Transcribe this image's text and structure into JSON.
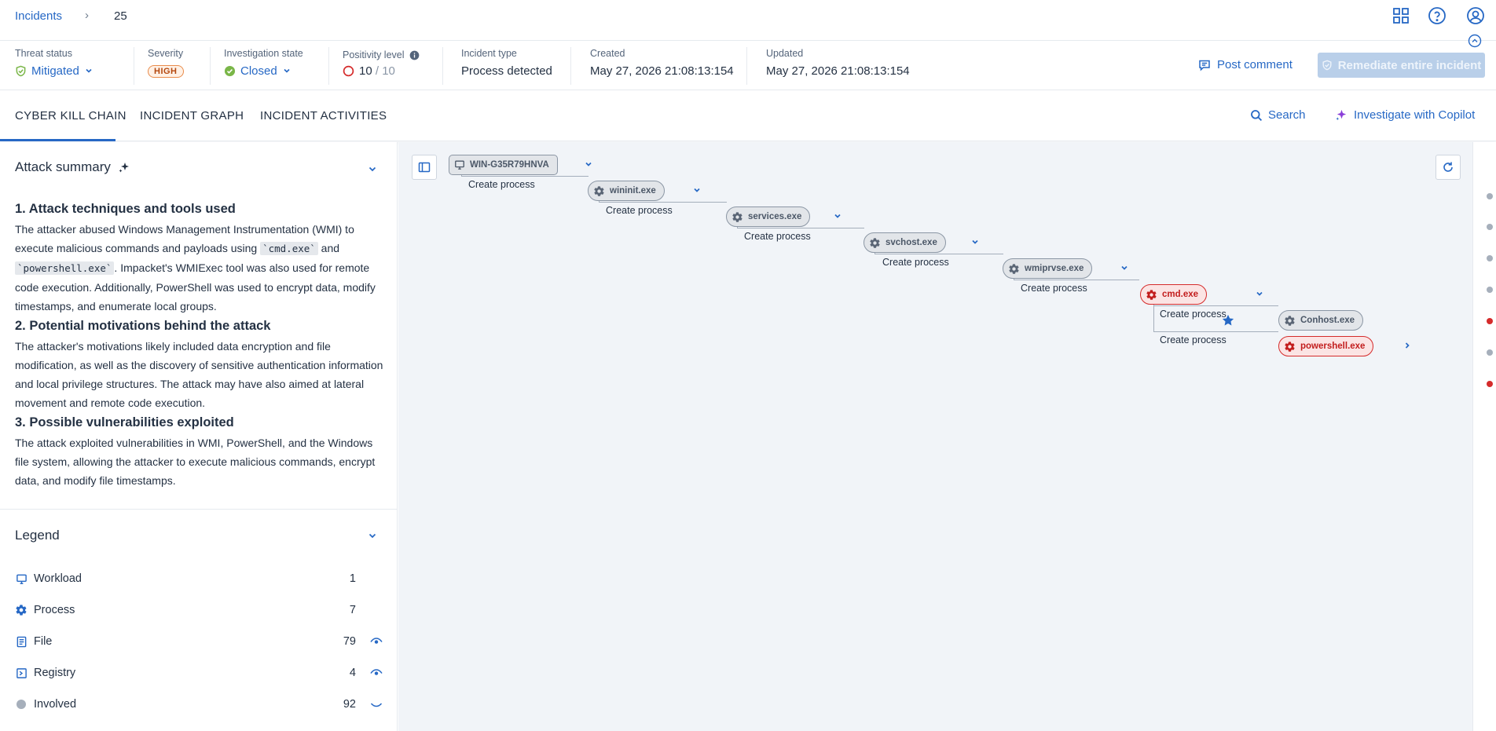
{
  "breadcrumb": {
    "parent": "Incidents",
    "separator": "›",
    "current": "25"
  },
  "header": {
    "threat_status": {
      "label": "Threat status",
      "value": "Mitigated"
    },
    "severity": {
      "label": "Severity",
      "value": "HIGH"
    },
    "investigation_state": {
      "label": "Investigation state",
      "value": "Closed"
    },
    "positivity": {
      "label": "Positivity level",
      "value": "10",
      "max": " / 10"
    },
    "incident_type": {
      "label": "Incident type",
      "value": "Process detected"
    },
    "created": {
      "label": "Created",
      "value": "May 27, 2026 21:08:13:154"
    },
    "updated": {
      "label": "Updated",
      "value": "May 27, 2026 21:08:13:154"
    },
    "post_comment": "Post comment",
    "remediate": "Remediate entire incident"
  },
  "tabs": [
    {
      "label": "CYBER KILL CHAIN",
      "active": true
    },
    {
      "label": "INCIDENT GRAPH",
      "active": false
    },
    {
      "label": "INCIDENT ACTIVITIES",
      "active": false
    }
  ],
  "actions": {
    "search": "Search",
    "copilot": "Investigate with Copilot"
  },
  "summary": {
    "title": "Attack summary",
    "h1": "1. Attack techniques and tools used",
    "p1a": "The attacker abused Windows Management Instrumentation (WMI) to execute malicious commands and payloads using ",
    "p1_code1": "`cmd.exe`",
    "p1b": " and ",
    "p1_code2": "`powershell.exe`",
    "p1c": ". Impacket's WMIExec tool was also used for remote code execution. Additionally, PowerShell was used to encrypt data, modify timestamps, and enumerate local groups.",
    "h2": "2. Potential motivations behind the attack",
    "p2": "The attacker's motivations likely included data encryption and file modification, as well as the discovery of sensitive authentication information and local privilege structures. The attack may have also aimed at lateral movement and remote code execution.",
    "h3": "3. Possible vulnerabilities exploited",
    "p3": "The attack exploited vulnerabilities in WMI, PowerShell, and the Windows file system, allowing the attacker to execute malicious commands, encrypt data, and modify file timestamps."
  },
  "legend": {
    "title": "Legend",
    "items": [
      {
        "name": "Workload",
        "count": "1"
      },
      {
        "name": "Process",
        "count": "7"
      },
      {
        "name": "File",
        "count": "79"
      },
      {
        "name": "Registry",
        "count": "4"
      },
      {
        "name": "Involved",
        "count": "92"
      }
    ]
  },
  "graph": {
    "host": "WIN-G35R79HNVA",
    "edge_label": "Create process",
    "nodes": [
      "wininit.exe",
      "services.exe",
      "svchost.exe",
      "wmiprvse.exe",
      "cmd.exe",
      "Conhost.exe",
      "powershell.exe"
    ]
  },
  "colors": {
    "accent": "#2668c5",
    "danger": "#d52b2b",
    "success": "#7ab648",
    "canvas": "#f1f4f8"
  }
}
